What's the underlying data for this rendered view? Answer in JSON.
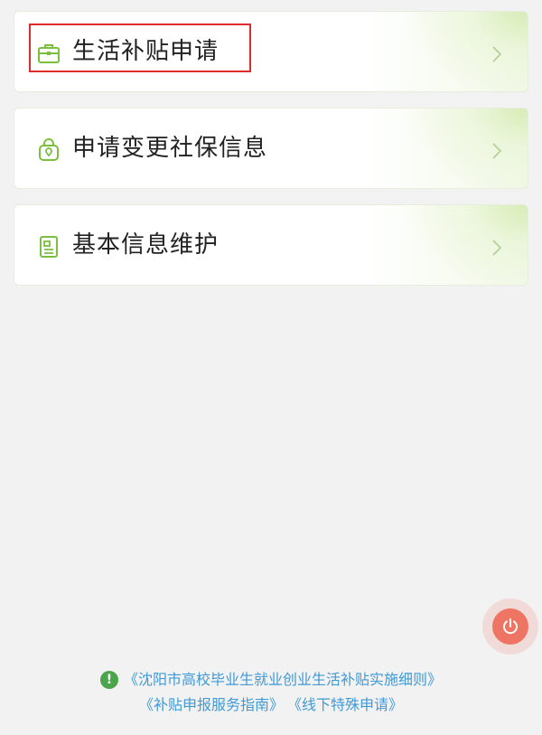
{
  "menu": {
    "items": [
      {
        "label": "生活补贴申请",
        "icon": "briefcase-icon"
      },
      {
        "label": "申请变更社保信息",
        "icon": "shopping-bag-icon"
      },
      {
        "label": "基本信息维护",
        "icon": "id-card-icon"
      }
    ]
  },
  "footer": {
    "links": [
      "《沈阳市高校毕业生就业创业生活补贴实施细则》",
      "《补贴申报服务指南》",
      "《线下特殊申请》"
    ]
  },
  "colors": {
    "accent_green": "#7bbf3f",
    "link_blue": "#3f9ad6",
    "power_red": "#ee7464",
    "highlight_red": "#e02b2b",
    "info_green": "#4aa54c"
  }
}
